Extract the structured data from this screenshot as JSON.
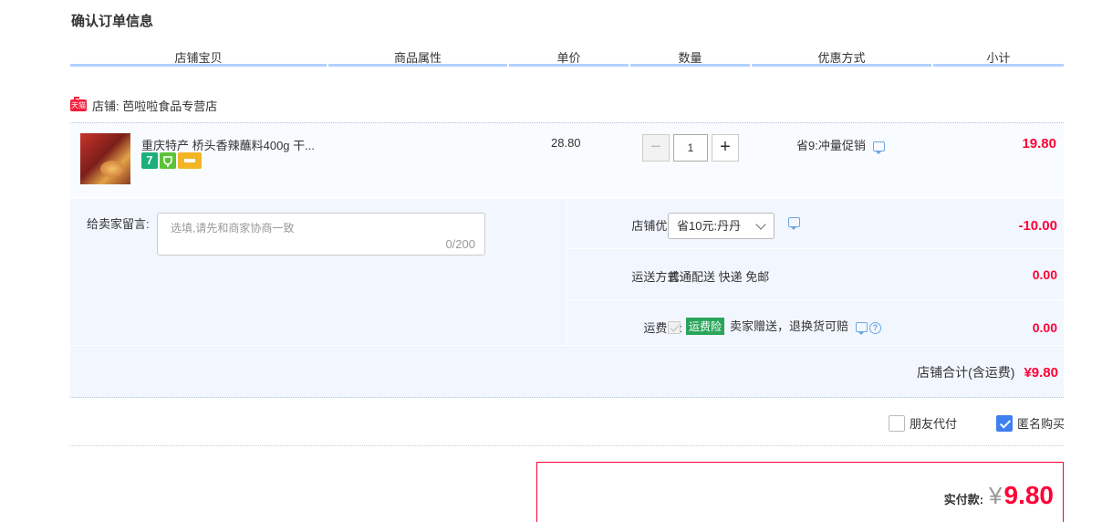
{
  "page_title": "确认订单信息",
  "columns": [
    "店铺宝贝",
    "商品属性",
    "单价",
    "数量",
    "优惠方式",
    "小计"
  ],
  "shop": {
    "badge": "天猫",
    "label": "店铺: 芭啦啦食品专营店"
  },
  "item": {
    "title": "重庆特产 桥头香辣蘸料400g 干...",
    "icons": [
      "seven-day-return-icon",
      "assurance-icon",
      "credit-card-icon"
    ],
    "icon_seven_text": "7",
    "unit_price": "28.80",
    "quantity": "1",
    "minus": "−",
    "plus": "+",
    "promotion": "省9:冲量促销",
    "subtotal": "19.80"
  },
  "message": {
    "label": "给卖家留言:",
    "placeholder": "选填,请先和商家协商一致",
    "counter": "0/200"
  },
  "shop_coupon": {
    "label": "店铺优惠:",
    "selected": "省10元:丹丹",
    "amount": "-10.00"
  },
  "shipping": {
    "label": "运送方式:",
    "value": "普通配送 快递 免邮",
    "amount": "0.00"
  },
  "insurance": {
    "label": "运费险:",
    "tag": "运费险",
    "text": "卖家赠送，退换货可赔",
    "help": "?",
    "amount": "0.00"
  },
  "shop_total": {
    "label": "店铺合计(含运费)",
    "amount": "¥9.80"
  },
  "options": {
    "friend_pay": {
      "label": "朋友代付",
      "checked": false
    },
    "anonymous": {
      "label": "匿名购买",
      "checked": true
    }
  },
  "payment": {
    "label": "实付款:",
    "currency": "¥",
    "amount": "9.80"
  },
  "colors": {
    "accent_red": "#ff0036",
    "header_rule": "#b2d1ff",
    "panel_bg": "#f2f7ff",
    "checkbox_blue": "#3f7ff0"
  }
}
